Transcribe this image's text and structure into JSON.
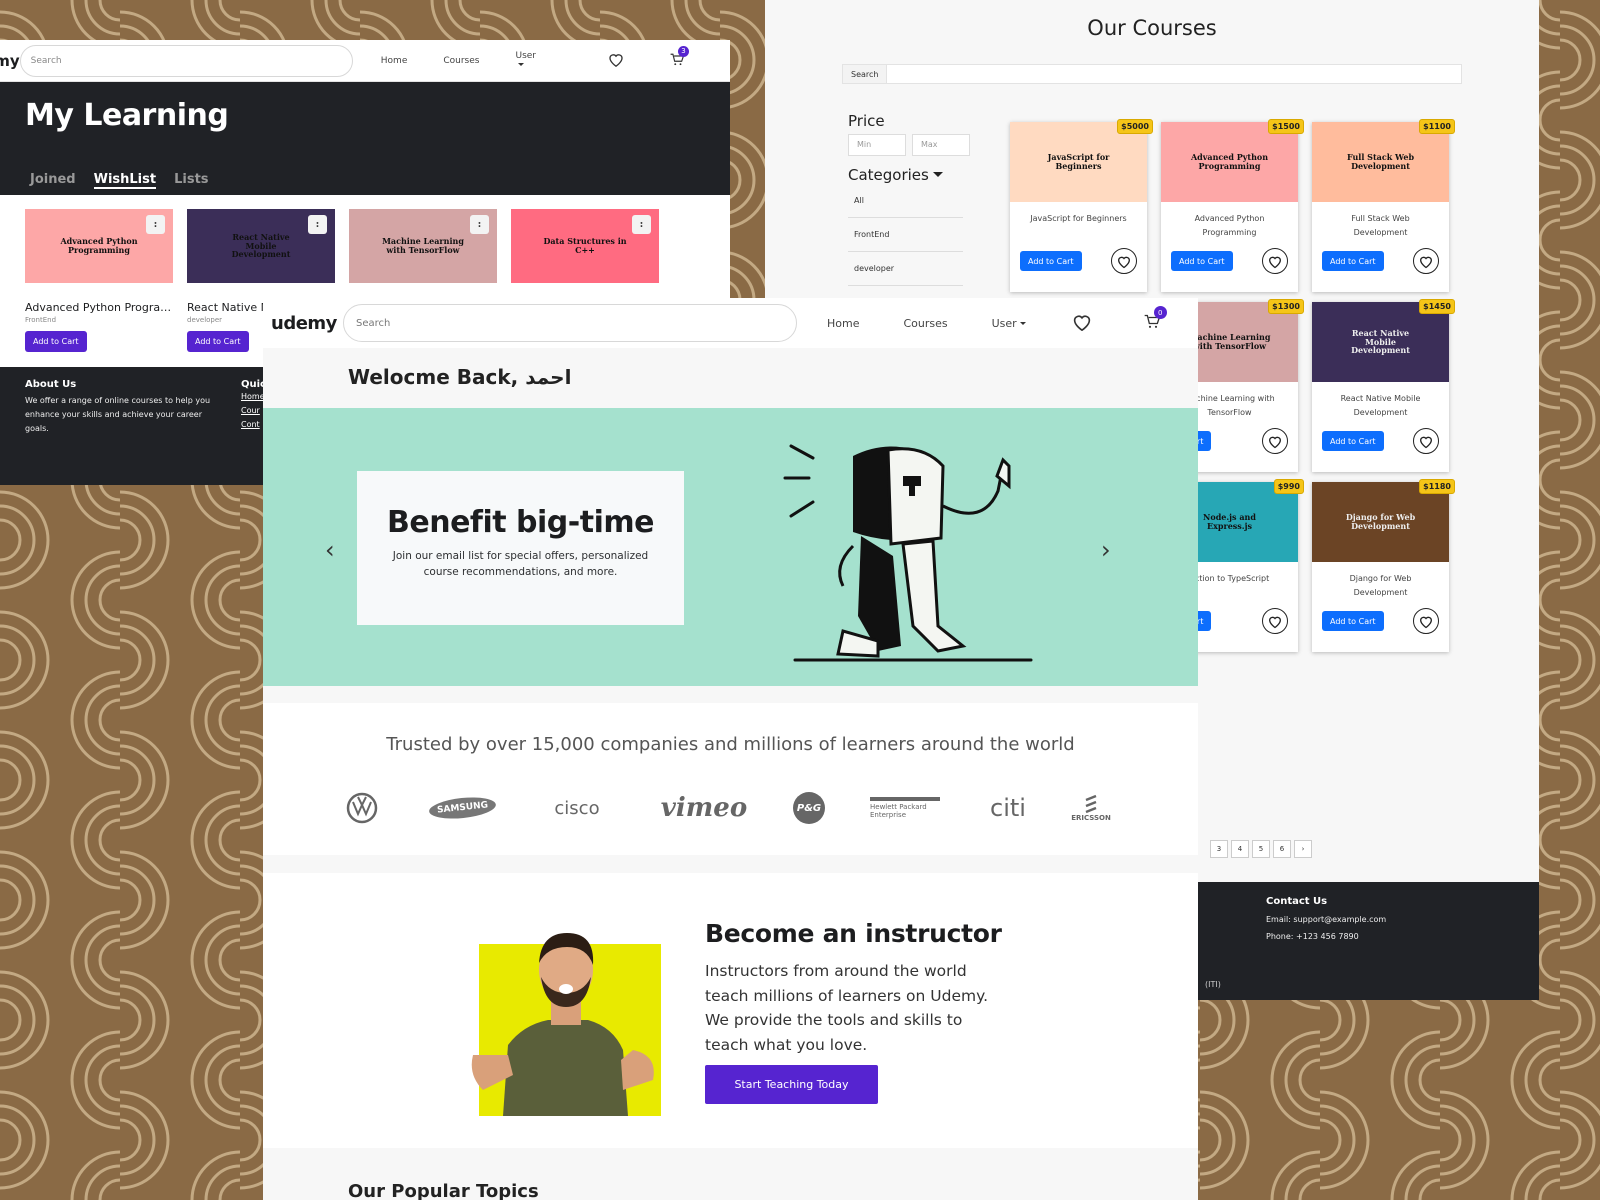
{
  "colors": {
    "udemy_purple": "#5624d0",
    "bootstrap_blue": "#0d6efd",
    "dark": "#202226",
    "hero_mint": "#a5e1ce",
    "price_badge": "#f5c518",
    "instructor_yellow": "#e8ea00",
    "background_brown": "#8a6a45"
  },
  "learning": {
    "logo": "my",
    "search_placeholder": "Search",
    "nav": {
      "home": "Home",
      "courses": "Courses",
      "user": "User"
    },
    "cart_count": "3",
    "title": "My Learning",
    "tabs": [
      {
        "label": "Joined"
      },
      {
        "label": "WishList"
      },
      {
        "label": "Lists"
      }
    ],
    "active_tab": "WishList",
    "cards": [
      {
        "thumb": "Advanced Python Programming",
        "title": "Advanced Python Progra…",
        "category": "FrontEnd",
        "button": "Add to Cart",
        "color": "#fda7a7",
        "text_color": "#111"
      },
      {
        "thumb": "React Native Mobile Development",
        "title": "React Native M",
        "category": "developer",
        "button": "Add to Cart",
        "color": "#3b2e58",
        "text_color": "#111"
      },
      {
        "thumb": "Machine Learning with TensorFlow",
        "title": "",
        "category": "",
        "button": "",
        "color": "#d4a5a5",
        "text_color": "#111"
      },
      {
        "thumb": "Data Structures in C++",
        "title": "",
        "category": "",
        "button": "",
        "color": "#ff6b81",
        "text_color": "#111"
      }
    ],
    "kebab": ":",
    "footer": {
      "about_title": "About Us",
      "about_text": "We offer a range of online courses to help you enhance your skills and achieve your career goals.",
      "quick_title": "Quic",
      "quick_links": [
        "Home",
        "Cour",
        "Cont"
      ]
    }
  },
  "courses": {
    "title": "Our Courses",
    "search_label": "Search",
    "price_title": "Price",
    "min_placeholder": "Min",
    "max_placeholder": "Max",
    "categories_title": "Categories",
    "categories": [
      "All",
      "FrontEnd",
      "developer"
    ],
    "cards": [
      {
        "thumb": "JavaScript for Beginners",
        "name": "JavaScript for Beginners",
        "price": "$5000",
        "color": "#ffdac1",
        "button": "Add to Cart"
      },
      {
        "thumb": "Advanced Python Programming",
        "name": "Advanced Python Programming",
        "price": "$1500",
        "color": "#fda7a7",
        "button": "Add to Cart"
      },
      {
        "thumb": "Full Stack Web Development",
        "name": "Full Stack Web Development",
        "price": "$1100",
        "color": "#ffbc9d",
        "button": "Add to Cart"
      },
      {
        "thumb": "achine Learning th TensorFlow",
        "name": "chine Learning with TensorFlow",
        "price": "",
        "color": "#d4a5a5",
        "button": "o Cart"
      },
      {
        "thumb": "Machine Learning with TensorFlow",
        "name": "Machine Learning with TensorFlow",
        "price": "$1300",
        "color": "#d4a5a5",
        "button": "o Cart"
      },
      {
        "thumb": "React Native Mobile Development",
        "name": "React Native Mobile Development",
        "price": "$1450",
        "color": "#3b2e58",
        "button": "Add to Cart"
      },
      {
        "thumb": "",
        "name": "",
        "price": "",
        "color": "#ffffff",
        "button": ""
      },
      {
        "thumb": "Node.js and Express.js",
        "name": "uction to TypeScript",
        "price": "$990",
        "color": "#27a7b5",
        "button": "o Cart"
      },
      {
        "thumb": "Django for Web Development",
        "name": "Django for Web Development",
        "price": "$1180",
        "color": "#6b4425",
        "button": "Add to Cart"
      }
    ],
    "pages": [
      "3",
      "4",
      "5",
      "6",
      "›"
    ],
    "footer": {
      "contact_title": "Contact Us",
      "email": "Email: support@example.com",
      "phone": "Phone: +123 456 7890",
      "copyright": "(ITI)"
    }
  },
  "home": {
    "logo_text": "udemy",
    "search_placeholder": "Search",
    "nav": {
      "home": "Home",
      "courses": "Courses",
      "user": "User"
    },
    "cart_count": "0",
    "welcome": "Welocme Back, احمد",
    "hero_title": "Benefit big-time",
    "hero_text": "Join our email list for special offers, personalized course recommendations, and more.",
    "prev_arrow": "‹",
    "next_arrow": "›",
    "trusted": "Trusted by over 15,000 companies and millions of learners around the world",
    "logos": [
      "VW",
      "SAMSUNG",
      "cisco",
      "vimeo",
      "P&G",
      "Hewlett Packard Enterprise",
      "citi",
      "ERICSSON"
    ],
    "instructor_title": "Become an instructor",
    "instructor_text": "Instructors from around the world teach millions of learners on Udemy. We provide the tools and skills to teach what you love.",
    "instructor_button": "Start Teaching Today",
    "popular_title": "Our Popular Topics"
  }
}
